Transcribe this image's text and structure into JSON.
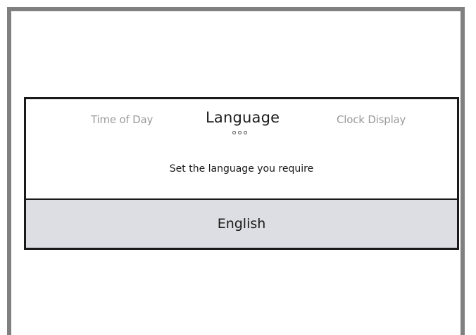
{
  "tabs": {
    "previous": "Time of Day",
    "current": "Language",
    "next": "Clock Display"
  },
  "page_indicator": {
    "count": 3
  },
  "instruction": "Set the language you require",
  "selected_option": "English"
}
